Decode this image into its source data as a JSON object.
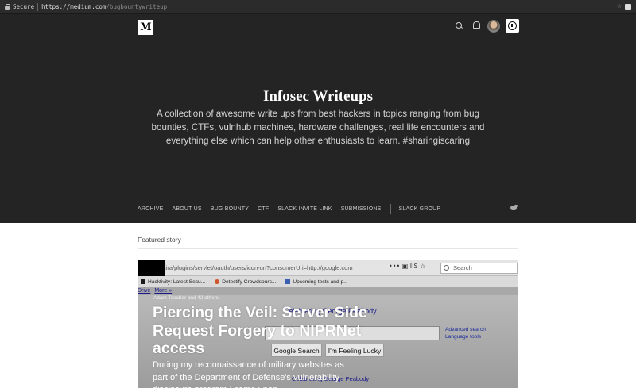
{
  "browser": {
    "secure_label": "Secure",
    "url_host": "https://medium.com",
    "url_path": "/bugbountywriteup"
  },
  "header": {
    "logo_letter": "M"
  },
  "hero": {
    "title": "Infosec Writeups",
    "description": "A collection of awesome write ups from best hackers in topics ranging from bug bounties, CTFs, vulnhub machines, hardware challenges, real life encounters and everything else which can help other enthusiasts to learn. #sharingiscaring"
  },
  "nav": {
    "items": [
      "ARCHIVE",
      "ABOUT US",
      "BUG BOUNTY",
      "CTF",
      "SLACK INVITE LINK",
      "SUBMISSIONS"
    ],
    "extra": "SLACK GROUP"
  },
  "featured": {
    "label": "Featured story",
    "image": {
      "url": "jira/plugins/servlet/oauth/users/icon-uri?consumerUri=http://google.com",
      "search_placeholder": "Search",
      "toolbar_glyphs": "•••  ▣  IIS  ☆",
      "bookmarks": [
        "Hacktivity: Latest Secu...",
        "Detectify Crowdsourc...",
        "Upcoming tests and p..."
      ],
      "links": [
        "Drive",
        "More »"
      ],
      "celebrating": "Celebrating George Peabody",
      "search_button": "Google Search",
      "lucky_button": "I'm Feeling Lucky",
      "advanced_search": "Advanced search",
      "language_tools": "Language tools",
      "bottom_link": "Celebrating George Peabody"
    },
    "recommend": "Adam Toecher and 42 others",
    "title": "Piercing the Veil: Server Side Request Forgery to NIPRNet access",
    "subtitle": "During my reconnaissance of military websites as part of the Department of Defense's vulnerability disclosure program I came upon..."
  },
  "colors": {
    "hero_bg": "#242424",
    "page_bg": "#ffffff"
  }
}
